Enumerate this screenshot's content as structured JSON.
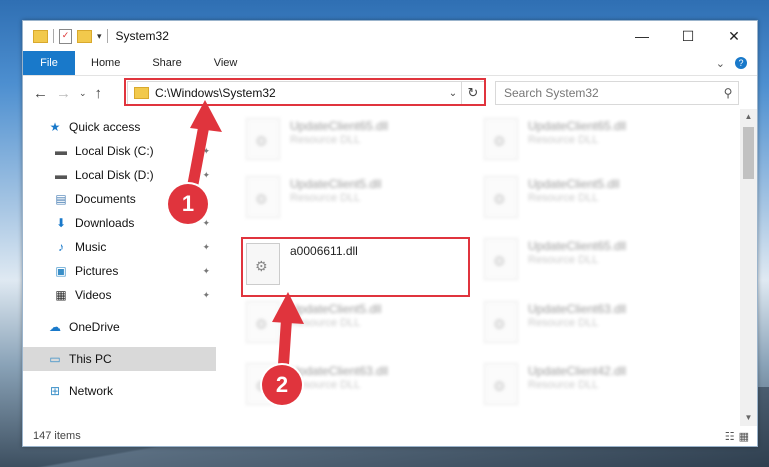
{
  "window": {
    "title": "System32",
    "qa_menu_glyph": "▾",
    "controls": {
      "minimize": "—",
      "maximize": "☐",
      "close": "✕"
    }
  },
  "ribbon": {
    "tabs": [
      "File",
      "Home",
      "Share",
      "View"
    ],
    "collapse_glyph": "⌄",
    "help_glyph": "?"
  },
  "nav_buttons": {
    "back": "←",
    "forward": "→",
    "recent": "⌄",
    "up": "↑"
  },
  "address": {
    "path": "C:\\Windows\\System32",
    "dropdown_glyph": "⌄",
    "refresh_glyph": "↻"
  },
  "search": {
    "placeholder": "Search System32",
    "icon_glyph": "⚲"
  },
  "sidebar": {
    "items": [
      {
        "label": "Quick access",
        "icon": "★",
        "pinned": false
      },
      {
        "label": "Local Disk (C:)",
        "icon": "▬",
        "pinned": true
      },
      {
        "label": "Local Disk (D:)",
        "icon": "▬",
        "pinned": true
      },
      {
        "label": "Documents",
        "icon": "▤",
        "pinned": true
      },
      {
        "label": "Downloads",
        "icon": "⬇",
        "pinned": true
      },
      {
        "label": "Music",
        "icon": "♪",
        "pinned": true
      },
      {
        "label": "Pictures",
        "icon": "▣",
        "pinned": true
      },
      {
        "label": "Videos",
        "icon": "▦",
        "pinned": true
      },
      {
        "label": "OneDrive",
        "icon": "☁",
        "pinned": false
      },
      {
        "label": "This PC",
        "icon": "▭",
        "pinned": false
      },
      {
        "label": "Network",
        "icon": "⊞",
        "pinned": false
      }
    ],
    "pin_glyph": "✦"
  },
  "files": [
    {
      "name": "UpdateClient65.dll",
      "type": "Resource DLL",
      "blurred": true
    },
    {
      "name": "UpdateClient65.dll",
      "type": "Resource DLL",
      "blurred": true
    },
    {
      "name": "UpdateClient5.dll",
      "type": "Resource DLL",
      "blurred": true
    },
    {
      "name": "UpdateClient5.dll",
      "type": "Resource DLL",
      "blurred": true
    },
    {
      "name": "a0006611.dll",
      "type": "",
      "blurred": false
    },
    {
      "name": "UpdateClient65.dll",
      "type": "Resource DLL",
      "blurred": true
    },
    {
      "name": "UpdateClient5.dll",
      "type": "Resource DLL",
      "blurred": true
    },
    {
      "name": "UpdateClient63.dll",
      "type": "Resource DLL",
      "blurred": true
    },
    {
      "name": "UpdateClient63.dll",
      "type": "Resource DLL",
      "blurred": true
    },
    {
      "name": "UpdateClient42.dll",
      "type": "Resource DLL",
      "blurred": true
    }
  ],
  "scroll": {
    "up_glyph": "▲",
    "down_glyph": "▼"
  },
  "status": {
    "item_count": "147 items",
    "details_glyph": "☷",
    "tiles_glyph": "▦"
  },
  "annotations": {
    "badge1": "1",
    "badge2": "2",
    "accent": "#e0343d"
  }
}
